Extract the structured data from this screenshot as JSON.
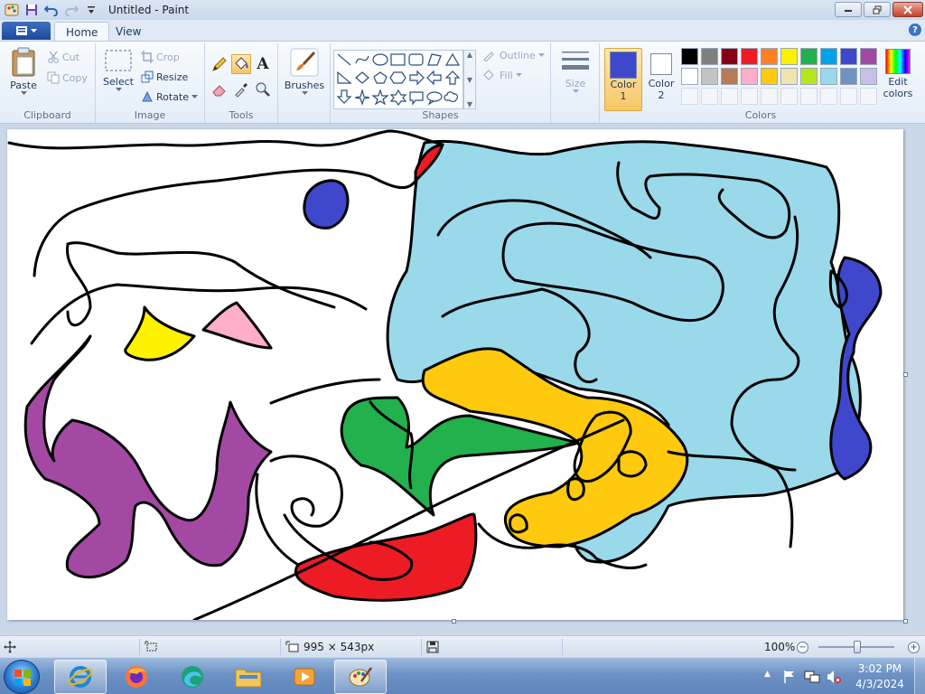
{
  "window": {
    "title": "Untitled - Paint"
  },
  "tabs": [
    {
      "label": "Home",
      "active": true
    },
    {
      "label": "View",
      "active": false
    }
  ],
  "ribbon": {
    "clipboard": {
      "label": "Clipboard",
      "paste": "Paste",
      "cut": "Cut",
      "copy": "Copy"
    },
    "image": {
      "label": "Image",
      "select": "Select",
      "crop": "Crop",
      "resize": "Resize",
      "rotate": "Rotate"
    },
    "tools": {
      "label": "Tools"
    },
    "brushes": {
      "label": "Brushes"
    },
    "shapes": {
      "label": "Shapes",
      "outline": "Outline",
      "fill": "Fill"
    },
    "size": {
      "label": "Size"
    },
    "colors": {
      "label": "Colors",
      "color1_label_line1": "Color",
      "color1_label_line2": "1",
      "color2_label_line1": "Color",
      "color2_label_line2": "2",
      "edit_line1": "Edit",
      "edit_line2": "colors",
      "color1": "#3f48cc",
      "color2": "#ffffff",
      "palette_row1": [
        "#000000",
        "#7f7f7f",
        "#880015",
        "#ed1c24",
        "#ff7f27",
        "#fff200",
        "#22b14c",
        "#00a2e8",
        "#3f48cc",
        "#a349a4"
      ],
      "palette_row2": [
        "#ffffff",
        "#c3c3c3",
        "#b97a57",
        "#ffaec9",
        "#ffc90e",
        "#efe4b0",
        "#b5e61d",
        "#99d9ea",
        "#7092be",
        "#c8bfe7"
      ]
    }
  },
  "status": {
    "canvas_size": "995 × 543px",
    "zoom": "100%"
  },
  "taskbar": {
    "time": "3:02 PM",
    "date": "4/3/2024"
  }
}
